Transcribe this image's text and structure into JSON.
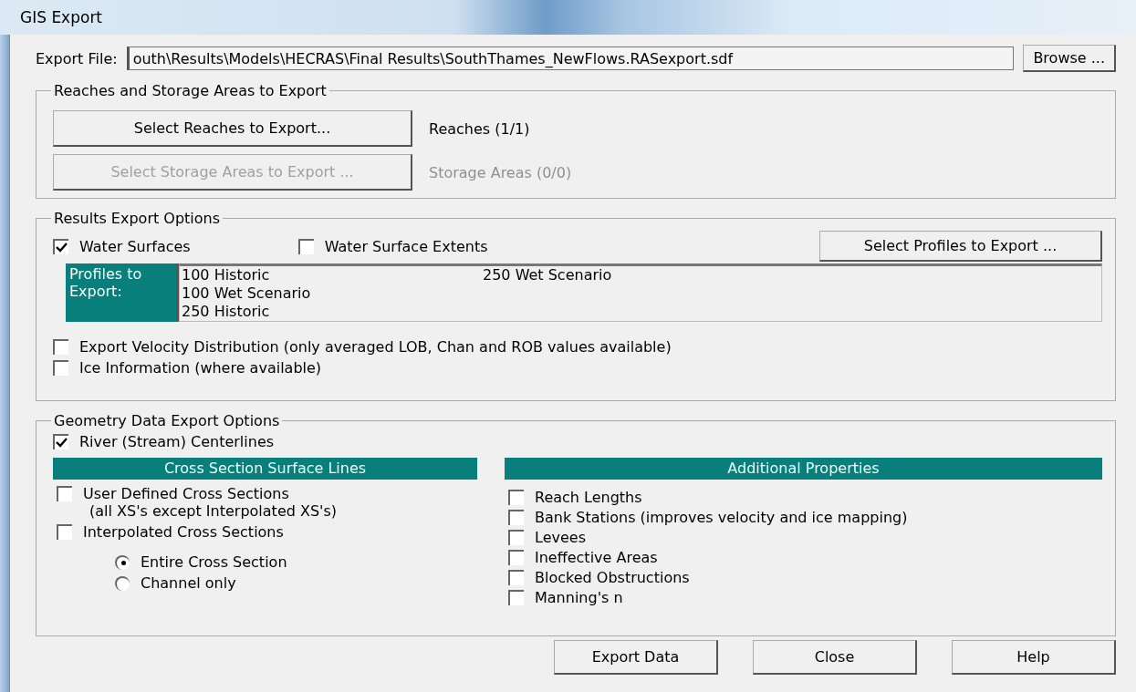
{
  "window": {
    "title": "GIS Export"
  },
  "export_file": {
    "label": "Export File:",
    "value": "outh\\Results\\Models\\HECRAS\\Final Results\\SouthThames_NewFlows.RASexport.sdf",
    "browse_button": "Browse ..."
  },
  "reaches_group": {
    "title": "Reaches and Storage Areas to Export",
    "rows": [
      {
        "button": "Select Reaches to Export...",
        "status": "Reaches (1/1)",
        "disabled": false
      },
      {
        "button": "Select Storage Areas to Export ...",
        "status": "Storage Areas (0/0)",
        "disabled": true
      }
    ]
  },
  "results_group": {
    "title": "Results Export Options",
    "water_surfaces": {
      "label": "Water Surfaces",
      "checked": true
    },
    "water_surface_extents": {
      "label": "Water Surface Extents",
      "checked": false
    },
    "select_profiles_button": "Select Profiles to Export ...",
    "profiles_label": "Profiles to Export:",
    "profiles": [
      "100 Historic",
      "100 Wet Scenario",
      "250 Historic",
      "250 Wet Scenario"
    ],
    "options": [
      {
        "label": "Export Velocity Distribution (only averaged LOB, Chan and ROB values available)",
        "checked": false
      },
      {
        "label": "Ice Information (where available)",
        "checked": false
      }
    ]
  },
  "geometry_group": {
    "title": "Geometry Data Export Options",
    "centerlines": {
      "label": "River (Stream) Centerlines",
      "checked": true
    },
    "cross_sections": {
      "header": "Cross Section Surface Lines",
      "items": [
        {
          "kind": "check",
          "label": "User Defined Cross Sections",
          "note": "(all XS's except Interpolated XS's)",
          "checked": false
        },
        {
          "kind": "check",
          "label": "Interpolated Cross Sections",
          "checked": false
        },
        {
          "kind": "radio",
          "label": "Entire Cross Section",
          "selected": true
        },
        {
          "kind": "radio",
          "label": "Channel only",
          "selected": false
        }
      ]
    },
    "additional": {
      "header": "Additional Properties",
      "items": [
        {
          "label": "Reach Lengths",
          "checked": false
        },
        {
          "label": "Bank Stations (improves velocity and ice mapping)",
          "checked": false
        },
        {
          "label": "Levees",
          "checked": false
        },
        {
          "label": "Ineffective Areas",
          "checked": false
        },
        {
          "label": "Blocked Obstructions",
          "checked": false
        },
        {
          "label": "Manning's n",
          "checked": false
        }
      ]
    }
  },
  "buttons": [
    "Export Data",
    "Close",
    "Help"
  ]
}
